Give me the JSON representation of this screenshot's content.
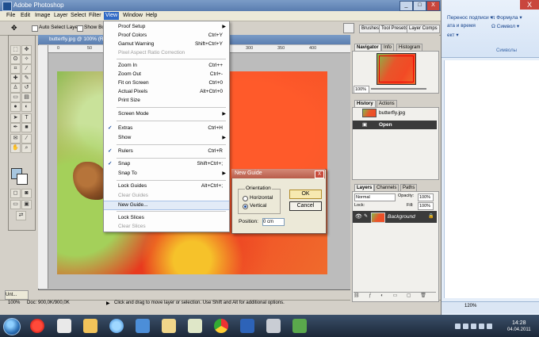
{
  "window": {
    "title": "Adobe Photoshop",
    "minimize": "_",
    "maximize": "□",
    "close": "X"
  },
  "menubar": [
    "File",
    "Edit",
    "Image",
    "Layer",
    "Select",
    "Filter",
    "View",
    "Window",
    "Help"
  ],
  "options_bar": {
    "auto_select": "Auto Select Layer",
    "show_bounding": "Show Bou",
    "tabs": [
      "Brushes",
      "Tool Presets",
      "Layer Comps"
    ]
  },
  "view_menu": {
    "items": [
      {
        "label": "Proof Setup",
        "shortcut": "",
        "submenu": true,
        "checked": false,
        "disabled": false
      },
      {
        "label": "Proof Colors",
        "shortcut": "Ctrl+Y",
        "submenu": false,
        "checked": false,
        "disabled": false
      },
      {
        "label": "Gamut Warning",
        "shortcut": "Shift+Ctrl+Y",
        "submenu": false,
        "checked": false,
        "disabled": false
      },
      {
        "label": "Pixel Aspect Ratio Correction",
        "shortcut": "",
        "submenu": false,
        "checked": false,
        "disabled": true
      },
      {
        "label": "Zoom In",
        "shortcut": "Ctrl++",
        "submenu": false,
        "checked": false,
        "disabled": false
      },
      {
        "label": "Zoom Out",
        "shortcut": "Ctrl+-",
        "submenu": false,
        "checked": false,
        "disabled": false
      },
      {
        "label": "Fit on Screen",
        "shortcut": "Ctrl+0",
        "submenu": false,
        "checked": false,
        "disabled": false
      },
      {
        "label": "Actual Pixels",
        "shortcut": "Alt+Ctrl+0",
        "submenu": false,
        "checked": false,
        "disabled": false
      },
      {
        "label": "Print Size",
        "shortcut": "",
        "submenu": false,
        "checked": false,
        "disabled": false
      },
      {
        "label": "Screen Mode",
        "shortcut": "",
        "submenu": true,
        "checked": false,
        "disabled": false
      },
      {
        "label": "Extras",
        "shortcut": "Ctrl+H",
        "submenu": false,
        "checked": true,
        "disabled": false
      },
      {
        "label": "Show",
        "shortcut": "",
        "submenu": true,
        "checked": false,
        "disabled": false
      },
      {
        "label": "Rulers",
        "shortcut": "Ctrl+R",
        "submenu": false,
        "checked": true,
        "disabled": false
      },
      {
        "label": "Snap",
        "shortcut": "Shift+Ctrl+;",
        "submenu": false,
        "checked": true,
        "disabled": false
      },
      {
        "label": "Snap To",
        "shortcut": "",
        "submenu": true,
        "checked": false,
        "disabled": false
      },
      {
        "label": "Lock Guides",
        "shortcut": "Alt+Ctrl+;",
        "submenu": false,
        "checked": false,
        "disabled": false
      },
      {
        "label": "Clear Guides",
        "shortcut": "",
        "submenu": false,
        "checked": false,
        "disabled": true
      },
      {
        "label": "New Guide...",
        "shortcut": "",
        "submenu": false,
        "checked": false,
        "disabled": false
      },
      {
        "label": "Lock Slices",
        "shortcut": "",
        "submenu": false,
        "checked": false,
        "disabled": false
      },
      {
        "label": "Clear Slices",
        "shortcut": "",
        "submenu": false,
        "checked": false,
        "disabled": true
      }
    ]
  },
  "document": {
    "title": "butterfly.jpg @ 100% (RGB/8)",
    "ruler_marks": [
      "0",
      "50",
      "100",
      "150",
      "200",
      "250",
      "300",
      "350",
      "400"
    ],
    "minimized_tab": "Unt..."
  },
  "dialog": {
    "title": "New Guide",
    "close": "X",
    "group": "Orientation",
    "horizontal": "Horizontal",
    "vertical": "Vertical",
    "position_label": "Position:",
    "position_value": "0 cm",
    "ok": "OK",
    "cancel": "Cancel"
  },
  "navigator": {
    "tabs": [
      "Navigator",
      "Info",
      "Histogram"
    ],
    "zoom": "100%"
  },
  "history": {
    "tabs": [
      "History",
      "Actions"
    ],
    "entries": [
      "butterfly.jpg",
      "Open"
    ]
  },
  "layers": {
    "tabs": [
      "Layers",
      "Channels",
      "Paths"
    ],
    "blend_mode": "Normal",
    "opacity_label": "Opacity:",
    "opacity": "100%",
    "lock_label": "Lock:",
    "fill_label": "Fill:",
    "fill": "100%",
    "layer_name": "Background"
  },
  "status": {
    "zoom": "100%",
    "doc": "Doc: 900,0K/900,0K",
    "hint": "Click and drag to move layer or selection.  Use Shift and Alt for additional options."
  },
  "word": {
    "line1": "Перенос подписи ▾",
    "line2": "ата и время",
    "line3": "ект ▾",
    "formula": "π Формула ▾",
    "symbol": "Ω Символ ▾",
    "group": "Символы",
    "close": "X",
    "zoom": "120%"
  },
  "taskbar": {
    "time": "14:28",
    "date": "04.04.2011"
  }
}
